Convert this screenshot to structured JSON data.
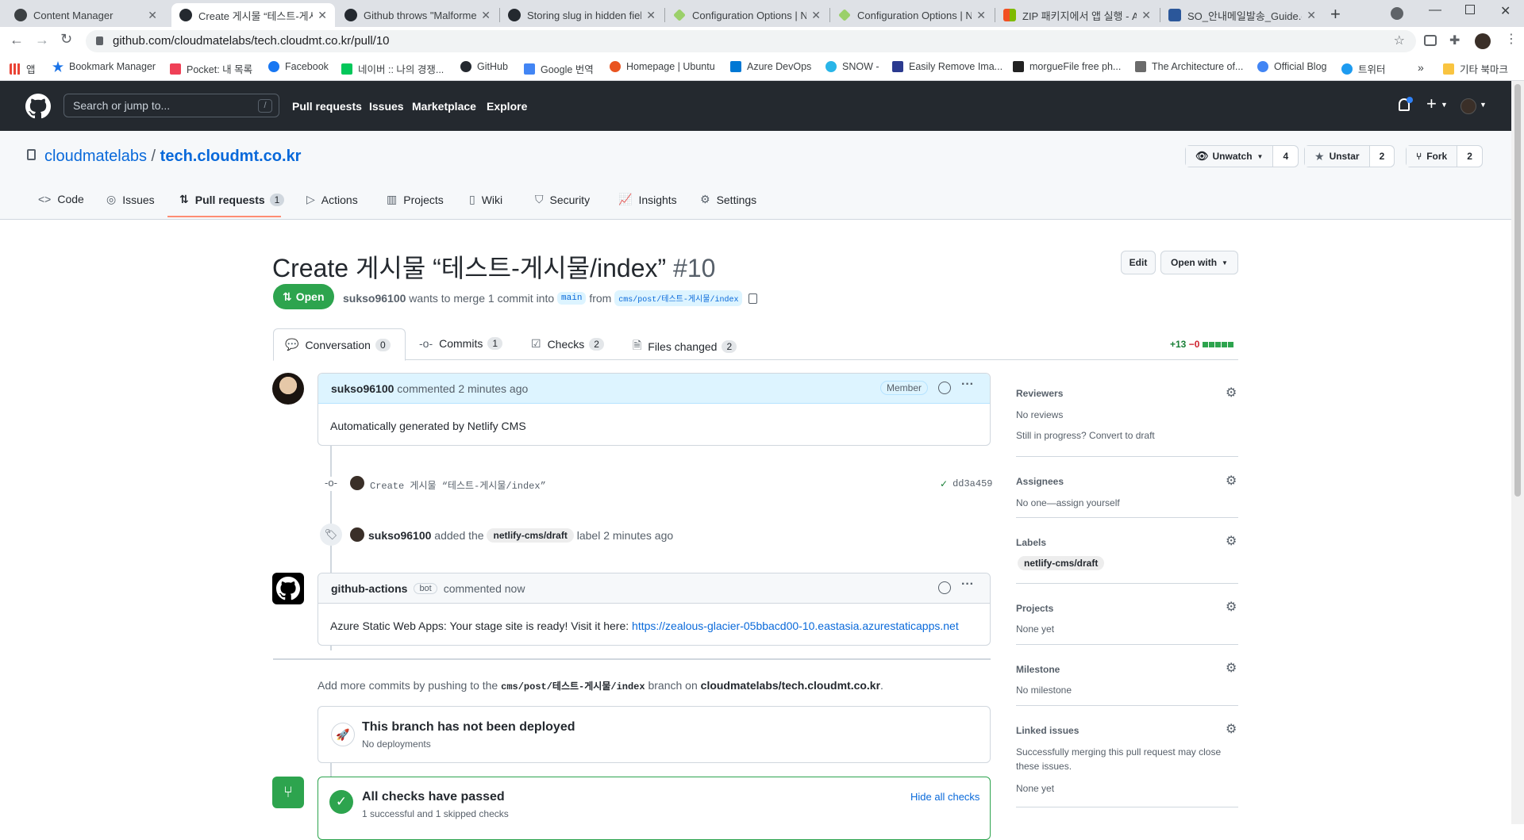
{
  "browser": {
    "tabs": [
      {
        "title": "Content Manager",
        "favicon_color": "#3c4043"
      },
      {
        "title": "Create 게시물 “테스트-게시물/index”",
        "favicon_color": "#24292f"
      },
      {
        "title": "Github throws \"Malformed",
        "favicon_color": "#24292f"
      },
      {
        "title": "Storing slug in hidden field",
        "favicon_color": "#24292f"
      },
      {
        "title": "Configuration Options | N",
        "favicon_color": "#9bd06a"
      },
      {
        "title": "Configuration Options | N",
        "favicon_color": "#9bd06a"
      },
      {
        "title": "ZIP 패키지에서 앱 실행 - Az",
        "favicon_color": "#f25022"
      },
      {
        "title": "SO_안내메일발송_Guide.docx",
        "favicon_color": "#2b579a"
      }
    ],
    "new_tab": "+",
    "url": "github.com/cloudmatelabs/tech.cloudmt.co.kr/pull/10",
    "bookmarks": [
      {
        "label": "앱",
        "color": "#ea4335"
      },
      {
        "label": "Bookmark Manager",
        "color": "#1a73e8"
      },
      {
        "label": "Pocket: 내 목록",
        "color": "#ef4056"
      },
      {
        "label": "Facebook",
        "color": "#1877f2"
      },
      {
        "label": "네이버 :: 나의 경쟁...",
        "color": "#03c75a"
      },
      {
        "label": "GitHub",
        "color": "#24292f"
      },
      {
        "label": "Google 번역",
        "color": "#4285f4"
      },
      {
        "label": "Homepage | Ubuntu",
        "color": "#e95420"
      },
      {
        "label": "Azure DevOps",
        "color": "#0078d4"
      },
      {
        "label": "SNOW -",
        "color": "#29b5e8"
      },
      {
        "label": "Easily Remove Ima...",
        "color": "#2b3a8f"
      },
      {
        "label": "morgueFile free ph...",
        "color": "#222222"
      },
      {
        "label": "The Architecture of...",
        "color": "#6b6b6b"
      },
      {
        "label": "Official Blog",
        "color": "#4285f4"
      },
      {
        "label": "트위터",
        "color": "#1d9bf0"
      }
    ],
    "more": "»",
    "other_bookmarks": "기타 북마크"
  },
  "github_header": {
    "search_placeholder": "Search or jump to...",
    "search_key": "/",
    "nav": [
      "Pull requests",
      "Issues",
      "Marketplace",
      "Explore"
    ]
  },
  "repo": {
    "owner": "cloudmatelabs",
    "separator": "/",
    "name": "tech.cloudmt.co.kr",
    "unwatch_label": "Unwatch",
    "unwatch_count": "4",
    "unstar_label": "Unstar",
    "star_count": "2",
    "fork_label": "Fork",
    "fork_count": "2",
    "tabs": [
      {
        "label": "Code"
      },
      {
        "label": "Issues"
      },
      {
        "label": "Pull requests",
        "count": "1"
      },
      {
        "label": "Actions"
      },
      {
        "label": "Projects"
      },
      {
        "label": "Wiki"
      },
      {
        "label": "Security"
      },
      {
        "label": "Insights"
      },
      {
        "label": "Settings"
      }
    ]
  },
  "pr": {
    "title": "Create 게시물 “테스트-게시물/index”",
    "number": "#10",
    "edit_label": "Edit",
    "open_with_label": "Open with",
    "state": "Open",
    "author": "sukso96100",
    "merge_text": "wants to merge 1 commit into",
    "base_branch": "main",
    "from_text": "from",
    "head_branch": "cms/post/테스트-게시물/index",
    "tabs": [
      {
        "label": "Conversation",
        "count": "0"
      },
      {
        "label": "Commits",
        "count": "1"
      },
      {
        "label": "Checks",
        "count": "2"
      },
      {
        "label": "Files changed",
        "count": "2"
      }
    ],
    "additions": "+13",
    "deletions": "−0"
  },
  "timeline": {
    "comment1": {
      "author": "sukso96100",
      "meta": "commented 2 minutes ago",
      "badge": "Member",
      "body": "Automatically generated by Netlify CMS"
    },
    "commit": {
      "message": "Create 게시물 “테스트-게시물/index”",
      "sha": "dd3a459"
    },
    "label_event": {
      "actor": "sukso96100",
      "text_before": "added the",
      "label": "netlify-cms/draft",
      "text_after": "label 2 minutes ago"
    },
    "comment2": {
      "author": "github-actions",
      "bot_badge": "bot",
      "meta": "commented now",
      "body_prefix": "Azure Static Web Apps: Your stage site is ready! Visit it here:",
      "link": "https://zealous-glacier-05bbacd00-10.eastasia.azurestaticapps.net"
    },
    "push_hint": {
      "prefix": "Add more commits by pushing to the",
      "branch": "cms/post/테스트-게시물/index",
      "middle": "branch on",
      "repo": "cloudmatelabs/tech.cloudmt.co.kr",
      "suffix": "."
    },
    "deploy": {
      "title": "This branch has not been deployed",
      "subtitle": "No deployments"
    },
    "checks": {
      "title": "All checks have passed",
      "subtitle": "1 successful and 1 skipped checks",
      "hide_label": "Hide all checks"
    }
  },
  "sidebar": {
    "reviewers": {
      "title": "Reviewers",
      "line1": "No reviews",
      "line2": "Still in progress? Convert to draft"
    },
    "assignees": {
      "title": "Assignees",
      "line1": "No one—assign yourself"
    },
    "labels": {
      "title": "Labels",
      "label": "netlify-cms/draft"
    },
    "projects": {
      "title": "Projects",
      "line1": "None yet"
    },
    "milestone": {
      "title": "Milestone",
      "line1": "No milestone"
    },
    "linked": {
      "title": "Linked issues",
      "line1": "Successfully merging this pull request may close",
      "line2": "these issues.",
      "line3": "None yet"
    }
  },
  "colors": {
    "open_green": "#2da44e",
    "link_blue": "#0969da",
    "header_dark": "#24292f",
    "tab_underline": "#fd8c73"
  }
}
